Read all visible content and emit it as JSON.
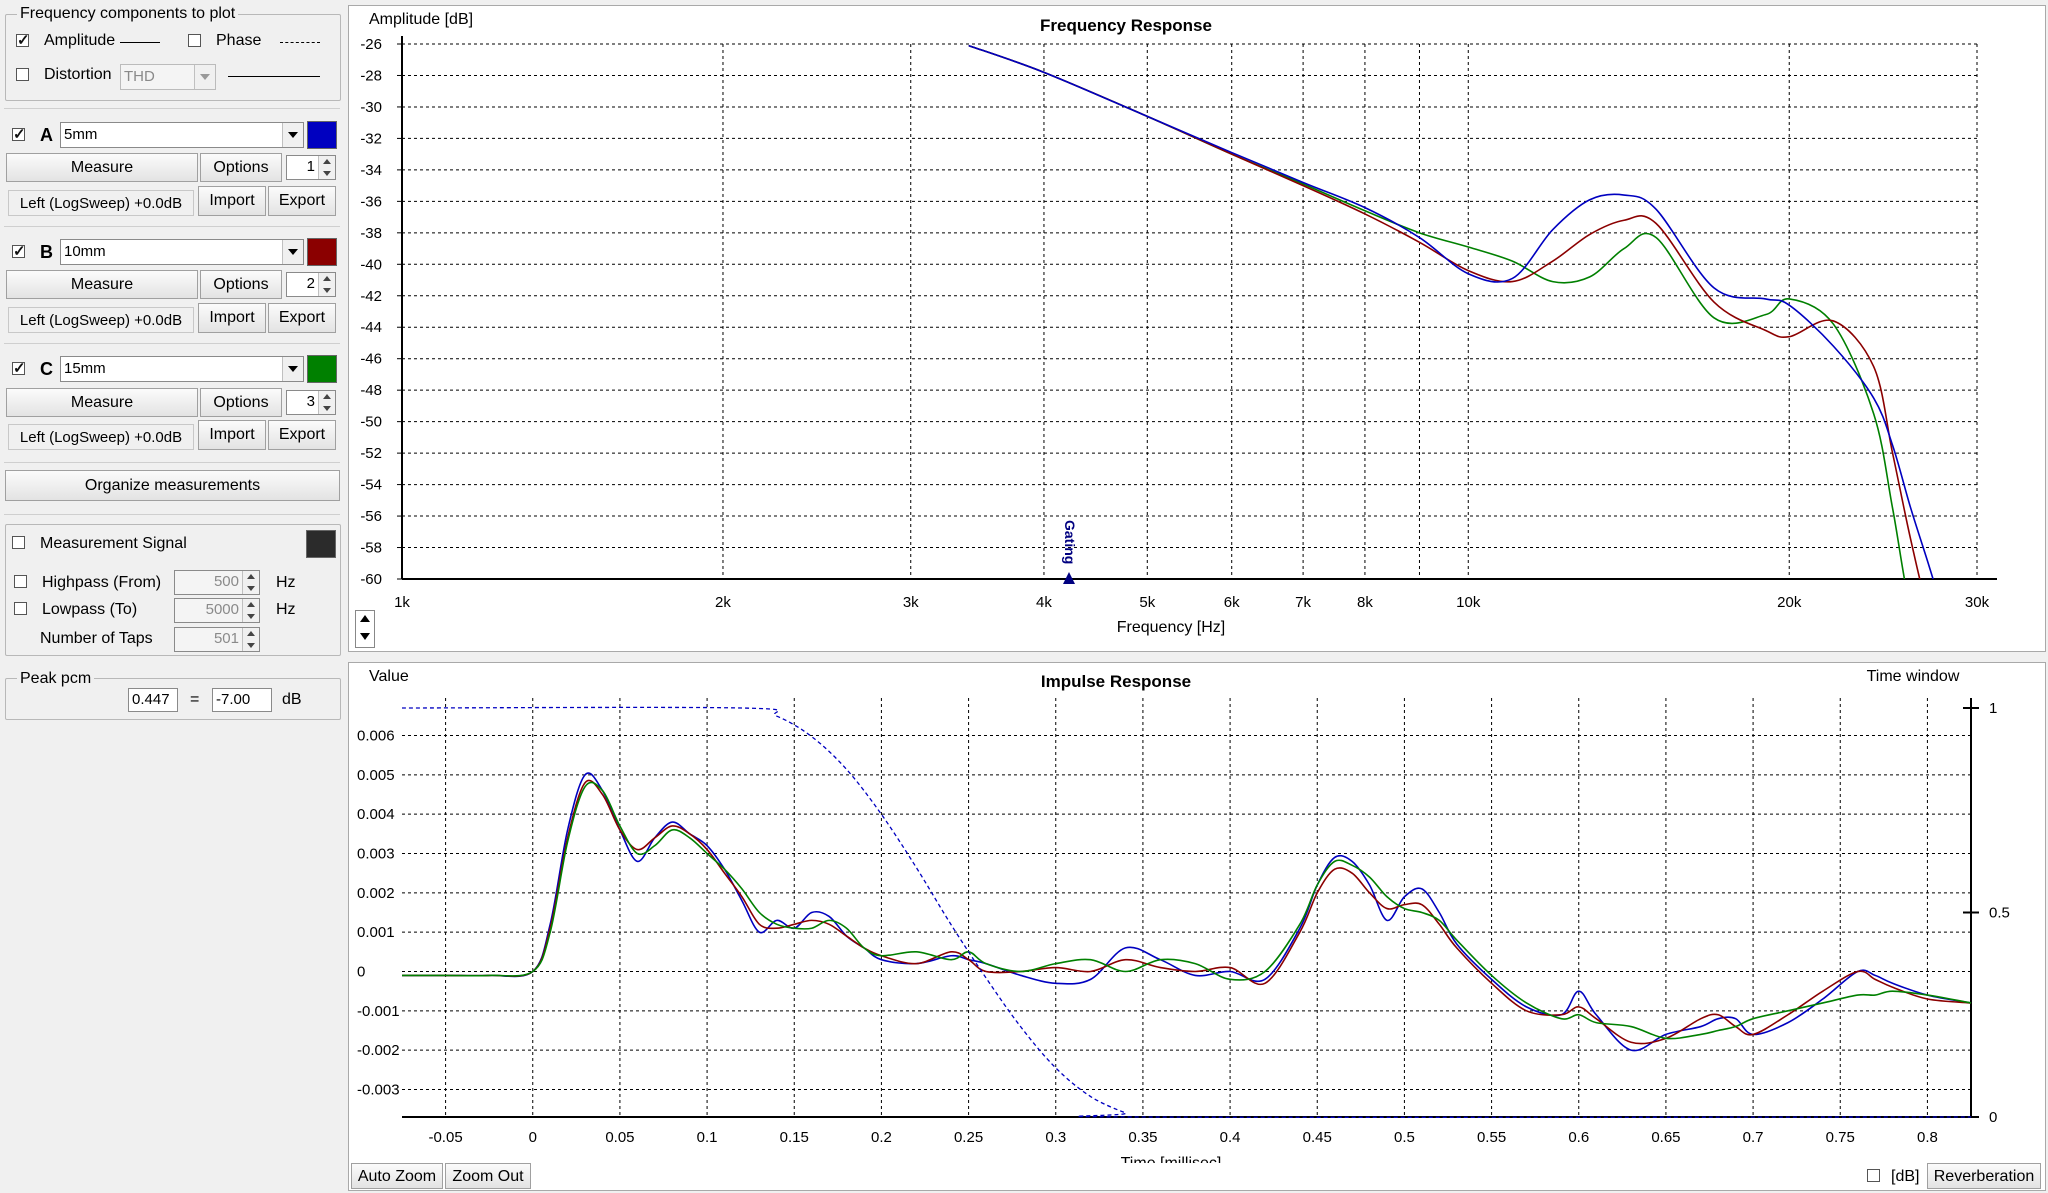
{
  "freq_components": {
    "title": "Frequency components to plot",
    "amplitude_label": "Amplitude",
    "amplitude_checked": true,
    "phase_label": "Phase",
    "phase_checked": false,
    "distortion_label": "Distortion",
    "distortion_checked": false,
    "distortion_type": "THD"
  },
  "measurements": [
    {
      "letter": "A",
      "checked": true,
      "name": "5mm",
      "color": "#0000c0",
      "measure": "Measure",
      "options": "Options",
      "index": "1",
      "source": "Left (LogSweep) +0.0dB",
      "import": "Import",
      "export": "Export"
    },
    {
      "letter": "B",
      "checked": true,
      "name": "10mm",
      "color": "#8b0000",
      "measure": "Measure",
      "options": "Options",
      "index": "2",
      "source": "Left (LogSweep) +0.0dB",
      "import": "Import",
      "export": "Export"
    },
    {
      "letter": "C",
      "checked": true,
      "name": "15mm",
      "color": "#008000",
      "measure": "Measure",
      "options": "Options",
      "index": "3",
      "source": "Left (LogSweep) +0.0dB",
      "import": "Import",
      "export": "Export"
    }
  ],
  "organize_label": "Organize measurements",
  "signal": {
    "label": "Measurement Signal",
    "checked": false,
    "color": "#2b2b2b",
    "highpass_label": "Highpass (From)",
    "highpass_value": "500",
    "lowpass_label": "Lowpass (To)",
    "lowpass_value": "5000",
    "hz": "Hz",
    "taps_label": "Number of Taps",
    "taps_value": "501"
  },
  "peak": {
    "title": "Peak pcm",
    "value": "0.447",
    "equals": "=",
    "db_value": "-7.00",
    "db": "dB"
  },
  "freq_chart": {
    "title": "Frequency Response",
    "ylabel": "Amplitude [dB]",
    "xlabel": "Frequency [Hz]",
    "gating_label": "Gating",
    "y_ticks": [
      "-26",
      "-28",
      "-30",
      "-32",
      "-34",
      "-36",
      "-38",
      "-40",
      "-42",
      "-44",
      "-46",
      "-48",
      "-50",
      "-52",
      "-54",
      "-56",
      "-58",
      "-60"
    ],
    "x_ticks": [
      "1k",
      "2k",
      "3k",
      "4k",
      "5k",
      "6k",
      "7k",
      "8k",
      "10k",
      "20k",
      "30k"
    ]
  },
  "impulse_chart": {
    "title": "Impulse Response",
    "ylabel": "Value",
    "xlabel": "Time [millisec]",
    "right_label": "Time window",
    "y_ticks": [
      "0.006",
      "0.005",
      "0.004",
      "0.003",
      "0.002",
      "0.001",
      "0",
      "-0.001",
      "-0.002",
      "-0.003"
    ],
    "x_ticks": [
      "-0.05",
      "0",
      "0.05",
      "0.1",
      "0.15",
      "0.2",
      "0.25",
      "0.3",
      "0.35",
      "0.4",
      "0.45",
      "0.5",
      "0.55",
      "0.6",
      "0.65",
      "0.7",
      "0.75",
      "0.8"
    ],
    "right_ticks": [
      "1",
      "0.5",
      "0"
    ],
    "auto_zoom": "Auto Zoom",
    "zoom_out": "Zoom Out",
    "db_label": "[dB]",
    "reverberation": "Reverberation"
  },
  "chart_data": [
    {
      "type": "line",
      "title": "Frequency Response",
      "xlabel": "Frequency [Hz]",
      "ylabel": "Amplitude [dB]",
      "x_scale": "log",
      "xlim": [
        1000,
        30000
      ],
      "ylim": [
        -60,
        -26
      ],
      "grid": true,
      "x": [
        3400,
        4000,
        5000,
        6000,
        7000,
        8000,
        9000,
        10000,
        11000,
        12000,
        13000,
        14000,
        15000,
        17000,
        19000,
        20000,
        22000,
        24000,
        25000,
        26000,
        27000,
        28000
      ],
      "series": [
        {
          "name": "A",
          "color": "#0000c0",
          "values": [
            -26.1,
            -27.8,
            -30.6,
            -32.9,
            -34.8,
            -36.4,
            -38.3,
            -40.6,
            -40.9,
            -37.8,
            -35.9,
            -35.6,
            -36.5,
            -41.5,
            -42.2,
            -42.6,
            -45.2,
            -48.5,
            -51.5,
            -55.5,
            -59.0,
            -62.5
          ]
        },
        {
          "name": "B",
          "color": "#8b0000",
          "values": [
            -26.1,
            -27.8,
            -30.6,
            -33.0,
            -35.0,
            -36.8,
            -38.6,
            -40.4,
            -41.1,
            -39.8,
            -38.1,
            -37.2,
            -37.4,
            -42.4,
            -44.2,
            -44.6,
            -43.6,
            -46.5,
            -52.0,
            -57.5,
            -62.0,
            -64.0
          ]
        },
        {
          "name": "C",
          "color": "#008000",
          "values": [
            -26.1,
            -27.8,
            -30.6,
            -33.0,
            -34.9,
            -36.6,
            -38.0,
            -38.9,
            -39.8,
            -41.1,
            -40.8,
            -39.0,
            -38.3,
            -43.4,
            -43.2,
            -42.2,
            -43.8,
            -49.5,
            -55.5,
            -62.0,
            -64.0,
            -64.0
          ]
        }
      ]
    },
    {
      "type": "line",
      "title": "Impulse Response",
      "xlabel": "Time [millisec]",
      "ylabel": "Value",
      "xlim": [
        -0.075,
        0.825
      ],
      "ylim": [
        -0.0037,
        0.0067
      ],
      "right_axis": {
        "label": "Time window",
        "ticks": [
          0,
          0.5,
          1
        ]
      },
      "grid": true,
      "x": [
        -0.075,
        -0.05,
        -0.025,
        0,
        0.01,
        0.02,
        0.03,
        0.04,
        0.05,
        0.06,
        0.07,
        0.08,
        0.09,
        0.1,
        0.11,
        0.12,
        0.13,
        0.14,
        0.15,
        0.16,
        0.17,
        0.18,
        0.19,
        0.2,
        0.22,
        0.24,
        0.25,
        0.26,
        0.28,
        0.3,
        0.32,
        0.34,
        0.36,
        0.38,
        0.4,
        0.42,
        0.44,
        0.45,
        0.46,
        0.47,
        0.48,
        0.49,
        0.5,
        0.51,
        0.52,
        0.53,
        0.55,
        0.57,
        0.59,
        0.6,
        0.61,
        0.63,
        0.65,
        0.67,
        0.68,
        0.69,
        0.7,
        0.72,
        0.74,
        0.76,
        0.77,
        0.78,
        0.8,
        0.825
      ],
      "series": [
        {
          "name": "A",
          "color": "#0000c0",
          "values": [
            -0.0001,
            -0.0001,
            -0.0001,
            0.0,
            0.0012,
            0.0036,
            0.005,
            0.0046,
            0.0036,
            0.0028,
            0.0034,
            0.0038,
            0.0035,
            0.0032,
            0.0026,
            0.0018,
            0.001,
            0.0013,
            0.0011,
            0.0015,
            0.0014,
            0.0009,
            0.0006,
            0.0003,
            0.0002,
            0.0004,
            0.0003,
            0.0002,
            -0.0001,
            -0.0003,
            -0.0002,
            0.0006,
            0.0003,
            -0.0001,
            0.0,
            -0.0002,
            0.0011,
            0.0022,
            0.0029,
            0.0028,
            0.0022,
            0.0013,
            0.0019,
            0.0021,
            0.0015,
            0.0007,
            -0.0002,
            -0.0009,
            -0.0011,
            -0.0005,
            -0.0011,
            -0.002,
            -0.0016,
            -0.0014,
            -0.0012,
            -0.0012,
            -0.0016,
            -0.0013,
            -0.0007,
            0.0,
            -0.0001,
            -0.0003,
            -0.0006,
            -0.0008
          ]
        },
        {
          "name": "B",
          "color": "#8b0000",
          "values": [
            -0.0001,
            -0.0001,
            -0.0001,
            0.0,
            0.0011,
            0.0034,
            0.0048,
            0.0045,
            0.0036,
            0.0031,
            0.0034,
            0.0037,
            0.0035,
            0.0031,
            0.0025,
            0.0019,
            0.0012,
            0.0011,
            0.0012,
            0.0013,
            0.0012,
            0.0009,
            0.0006,
            0.0004,
            0.0002,
            0.0005,
            0.0003,
            0.0,
            0.0,
            0.0001,
            0.0,
            0.0003,
            0.0001,
            0.0,
            0.0001,
            -0.0003,
            0.001,
            0.002,
            0.0026,
            0.0025,
            0.002,
            0.0016,
            0.0017,
            0.0017,
            0.0012,
            0.0006,
            -0.0003,
            -0.001,
            -0.0011,
            -0.0009,
            -0.0012,
            -0.0018,
            -0.0017,
            -0.0012,
            -0.0011,
            -0.0014,
            -0.0016,
            -0.0011,
            -0.0005,
            0.0,
            -0.0002,
            -0.0004,
            -0.0007,
            -0.0008
          ]
        },
        {
          "name": "C",
          "color": "#008000",
          "values": [
            -0.0001,
            -0.0001,
            -0.0001,
            0.0,
            0.001,
            0.0033,
            0.0047,
            0.0046,
            0.0037,
            0.003,
            0.0032,
            0.0036,
            0.0034,
            0.003,
            0.0026,
            0.0021,
            0.0015,
            0.0012,
            0.0011,
            0.0011,
            0.0013,
            0.0011,
            0.0006,
            0.0004,
            0.0005,
            0.0003,
            0.0005,
            0.0002,
            0.0,
            0.0002,
            0.0003,
            0.0,
            0.0003,
            0.0002,
            -0.0002,
            0.0,
            0.0012,
            0.0022,
            0.0028,
            0.0027,
            0.0024,
            0.0019,
            0.0016,
            0.0015,
            0.0013,
            0.0008,
            -0.0001,
            -0.0008,
            -0.0012,
            -0.0011,
            -0.0013,
            -0.0014,
            -0.0017,
            -0.0016,
            -0.0015,
            -0.0014,
            -0.0012,
            -0.001,
            -0.0008,
            -0.0006,
            -0.0006,
            -0.0005,
            -0.0006,
            -0.0008
          ]
        },
        {
          "name": "Time window",
          "color": "#0000c0",
          "dashed": true,
          "axis": "right",
          "x": [
            -0.075,
            0.12,
            0.14,
            0.16,
            0.18,
            0.2,
            0.22,
            0.24,
            0.26,
            0.28,
            0.3,
            0.32,
            0.34,
            0.35,
            0.825
          ],
          "values": [
            1.0,
            1.0,
            0.98,
            0.93,
            0.85,
            0.74,
            0.61,
            0.47,
            0.34,
            0.22,
            0.12,
            0.05,
            0.01,
            0.0,
            0.0
          ]
        }
      ]
    }
  ]
}
